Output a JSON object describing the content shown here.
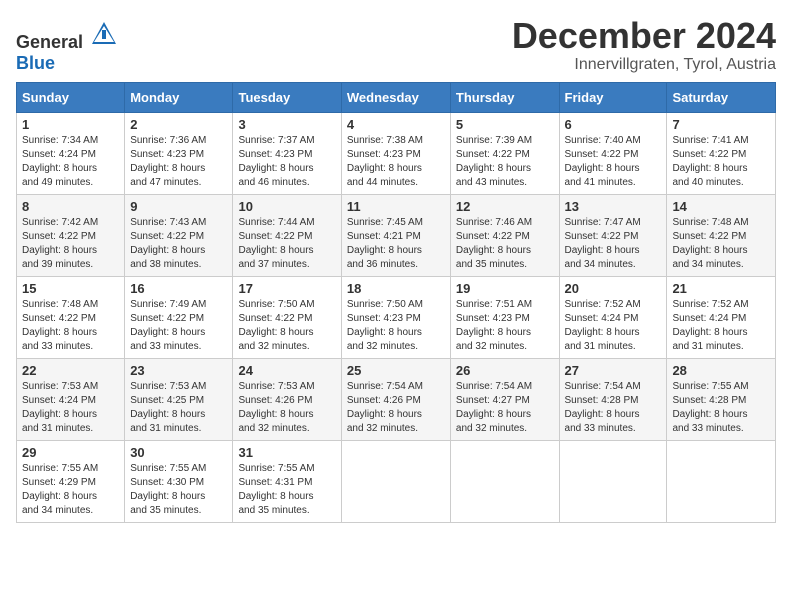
{
  "header": {
    "logo_general": "General",
    "logo_blue": "Blue",
    "title": "December 2024",
    "location": "Innervillgraten, Tyrol, Austria"
  },
  "calendar": {
    "days_of_week": [
      "Sunday",
      "Monday",
      "Tuesday",
      "Wednesday",
      "Thursday",
      "Friday",
      "Saturday"
    ],
    "weeks": [
      [
        {
          "day": "",
          "info": ""
        },
        {
          "day": "",
          "info": ""
        },
        {
          "day": "",
          "info": ""
        },
        {
          "day": "",
          "info": ""
        },
        {
          "day": "",
          "info": ""
        },
        {
          "day": "",
          "info": ""
        },
        {
          "day": "",
          "info": ""
        }
      ],
      [
        {
          "day": "1",
          "info": "Sunrise: 7:34 AM\nSunset: 4:24 PM\nDaylight: 8 hours\nand 49 minutes."
        },
        {
          "day": "2",
          "info": "Sunrise: 7:36 AM\nSunset: 4:23 PM\nDaylight: 8 hours\nand 47 minutes."
        },
        {
          "day": "3",
          "info": "Sunrise: 7:37 AM\nSunset: 4:23 PM\nDaylight: 8 hours\nand 46 minutes."
        },
        {
          "day": "4",
          "info": "Sunrise: 7:38 AM\nSunset: 4:23 PM\nDaylight: 8 hours\nand 44 minutes."
        },
        {
          "day": "5",
          "info": "Sunrise: 7:39 AM\nSunset: 4:22 PM\nDaylight: 8 hours\nand 43 minutes."
        },
        {
          "day": "6",
          "info": "Sunrise: 7:40 AM\nSunset: 4:22 PM\nDaylight: 8 hours\nand 41 minutes."
        },
        {
          "day": "7",
          "info": "Sunrise: 7:41 AM\nSunset: 4:22 PM\nDaylight: 8 hours\nand 40 minutes."
        }
      ],
      [
        {
          "day": "8",
          "info": "Sunrise: 7:42 AM\nSunset: 4:22 PM\nDaylight: 8 hours\nand 39 minutes."
        },
        {
          "day": "9",
          "info": "Sunrise: 7:43 AM\nSunset: 4:22 PM\nDaylight: 8 hours\nand 38 minutes."
        },
        {
          "day": "10",
          "info": "Sunrise: 7:44 AM\nSunset: 4:22 PM\nDaylight: 8 hours\nand 37 minutes."
        },
        {
          "day": "11",
          "info": "Sunrise: 7:45 AM\nSunset: 4:21 PM\nDaylight: 8 hours\nand 36 minutes."
        },
        {
          "day": "12",
          "info": "Sunrise: 7:46 AM\nSunset: 4:22 PM\nDaylight: 8 hours\nand 35 minutes."
        },
        {
          "day": "13",
          "info": "Sunrise: 7:47 AM\nSunset: 4:22 PM\nDaylight: 8 hours\nand 34 minutes."
        },
        {
          "day": "14",
          "info": "Sunrise: 7:48 AM\nSunset: 4:22 PM\nDaylight: 8 hours\nand 34 minutes."
        }
      ],
      [
        {
          "day": "15",
          "info": "Sunrise: 7:48 AM\nSunset: 4:22 PM\nDaylight: 8 hours\nand 33 minutes."
        },
        {
          "day": "16",
          "info": "Sunrise: 7:49 AM\nSunset: 4:22 PM\nDaylight: 8 hours\nand 33 minutes."
        },
        {
          "day": "17",
          "info": "Sunrise: 7:50 AM\nSunset: 4:22 PM\nDaylight: 8 hours\nand 32 minutes."
        },
        {
          "day": "18",
          "info": "Sunrise: 7:50 AM\nSunset: 4:23 PM\nDaylight: 8 hours\nand 32 minutes."
        },
        {
          "day": "19",
          "info": "Sunrise: 7:51 AM\nSunset: 4:23 PM\nDaylight: 8 hours\nand 32 minutes."
        },
        {
          "day": "20",
          "info": "Sunrise: 7:52 AM\nSunset: 4:24 PM\nDaylight: 8 hours\nand 31 minutes."
        },
        {
          "day": "21",
          "info": "Sunrise: 7:52 AM\nSunset: 4:24 PM\nDaylight: 8 hours\nand 31 minutes."
        }
      ],
      [
        {
          "day": "22",
          "info": "Sunrise: 7:53 AM\nSunset: 4:24 PM\nDaylight: 8 hours\nand 31 minutes."
        },
        {
          "day": "23",
          "info": "Sunrise: 7:53 AM\nSunset: 4:25 PM\nDaylight: 8 hours\nand 31 minutes."
        },
        {
          "day": "24",
          "info": "Sunrise: 7:53 AM\nSunset: 4:26 PM\nDaylight: 8 hours\nand 32 minutes."
        },
        {
          "day": "25",
          "info": "Sunrise: 7:54 AM\nSunset: 4:26 PM\nDaylight: 8 hours\nand 32 minutes."
        },
        {
          "day": "26",
          "info": "Sunrise: 7:54 AM\nSunset: 4:27 PM\nDaylight: 8 hours\nand 32 minutes."
        },
        {
          "day": "27",
          "info": "Sunrise: 7:54 AM\nSunset: 4:28 PM\nDaylight: 8 hours\nand 33 minutes."
        },
        {
          "day": "28",
          "info": "Sunrise: 7:55 AM\nSunset: 4:28 PM\nDaylight: 8 hours\nand 33 minutes."
        }
      ],
      [
        {
          "day": "29",
          "info": "Sunrise: 7:55 AM\nSunset: 4:29 PM\nDaylight: 8 hours\nand 34 minutes."
        },
        {
          "day": "30",
          "info": "Sunrise: 7:55 AM\nSunset: 4:30 PM\nDaylight: 8 hours\nand 35 minutes."
        },
        {
          "day": "31",
          "info": "Sunrise: 7:55 AM\nSunset: 4:31 PM\nDaylight: 8 hours\nand 35 minutes."
        },
        {
          "day": "",
          "info": ""
        },
        {
          "day": "",
          "info": ""
        },
        {
          "day": "",
          "info": ""
        },
        {
          "day": "",
          "info": ""
        }
      ]
    ]
  }
}
